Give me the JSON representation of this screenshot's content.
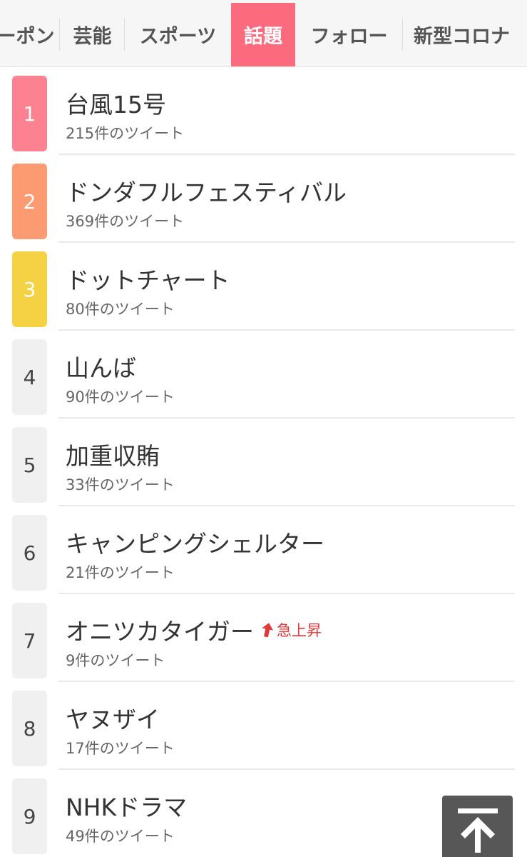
{
  "tabs": [
    {
      "label": "ーポン",
      "active": false
    },
    {
      "label": "芸能",
      "active": false
    },
    {
      "label": "スポーツ",
      "active": false
    },
    {
      "label": "話題",
      "active": true
    },
    {
      "label": "フォロー",
      "active": false
    },
    {
      "label": "新型コロナ",
      "active": false
    }
  ],
  "colors": {
    "active_tab": "#fc6a7d",
    "rank1": "#fc8291",
    "rank2": "#fc9a72",
    "rank3": "#f5d243",
    "rank_default": "#f0f0f0",
    "surge": "#e0383b",
    "to_top": "#575757"
  },
  "ranking": [
    {
      "rank": "1",
      "title": "台風15号",
      "count": "215件のツイート"
    },
    {
      "rank": "2",
      "title": "ドンダフルフェスティバル",
      "count": "369件のツイート"
    },
    {
      "rank": "3",
      "title": "ドットチャート",
      "count": "80件のツイート"
    },
    {
      "rank": "4",
      "title": "山んば",
      "count": "90件のツイート"
    },
    {
      "rank": "5",
      "title": "加重収賄",
      "count": "33件のツイート"
    },
    {
      "rank": "6",
      "title": "キャンピングシェルター",
      "count": "21件のツイート"
    },
    {
      "rank": "7",
      "title": "オニツカタイガー",
      "count": "9件のツイート",
      "badge": "急上昇",
      "badge_icon": "arrow-up-icon"
    },
    {
      "rank": "8",
      "title": "ヤヌザイ",
      "count": "17件のツイート"
    },
    {
      "rank": "9",
      "title": "NHKドラマ",
      "count": "49件のツイート"
    }
  ],
  "back_to_top": {
    "icon": "arrow-to-top-icon"
  }
}
